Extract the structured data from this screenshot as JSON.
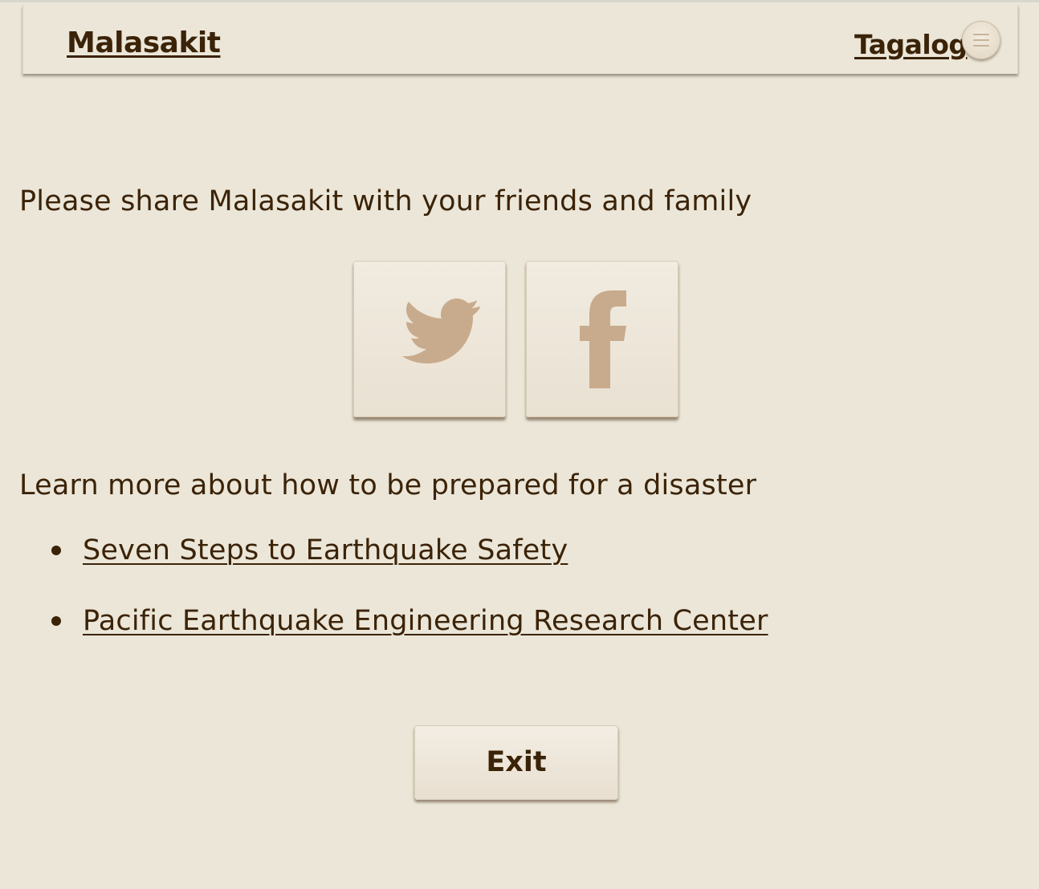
{
  "header": {
    "brand": "Malasakit",
    "language_link": "Tagalog",
    "menu_icon": "hamburger-menu-icon"
  },
  "share": {
    "text": "Please share Malasakit with your friends and family",
    "buttons": [
      {
        "icon": "twitter-bird-icon"
      },
      {
        "icon": "facebook-f-icon"
      }
    ]
  },
  "learn": {
    "text": "Learn more about how to be prepared for a disaster",
    "links": [
      {
        "label": "Seven Steps to Earthquake Safety"
      },
      {
        "label": "Pacific Earthquake Engineering Research Center"
      }
    ]
  },
  "exit": {
    "label": "Exit"
  },
  "colors": {
    "background": "#ebe6d8",
    "text": "#3b2308",
    "icon": "#c8ab8d",
    "button_face": "#efe8dc"
  }
}
